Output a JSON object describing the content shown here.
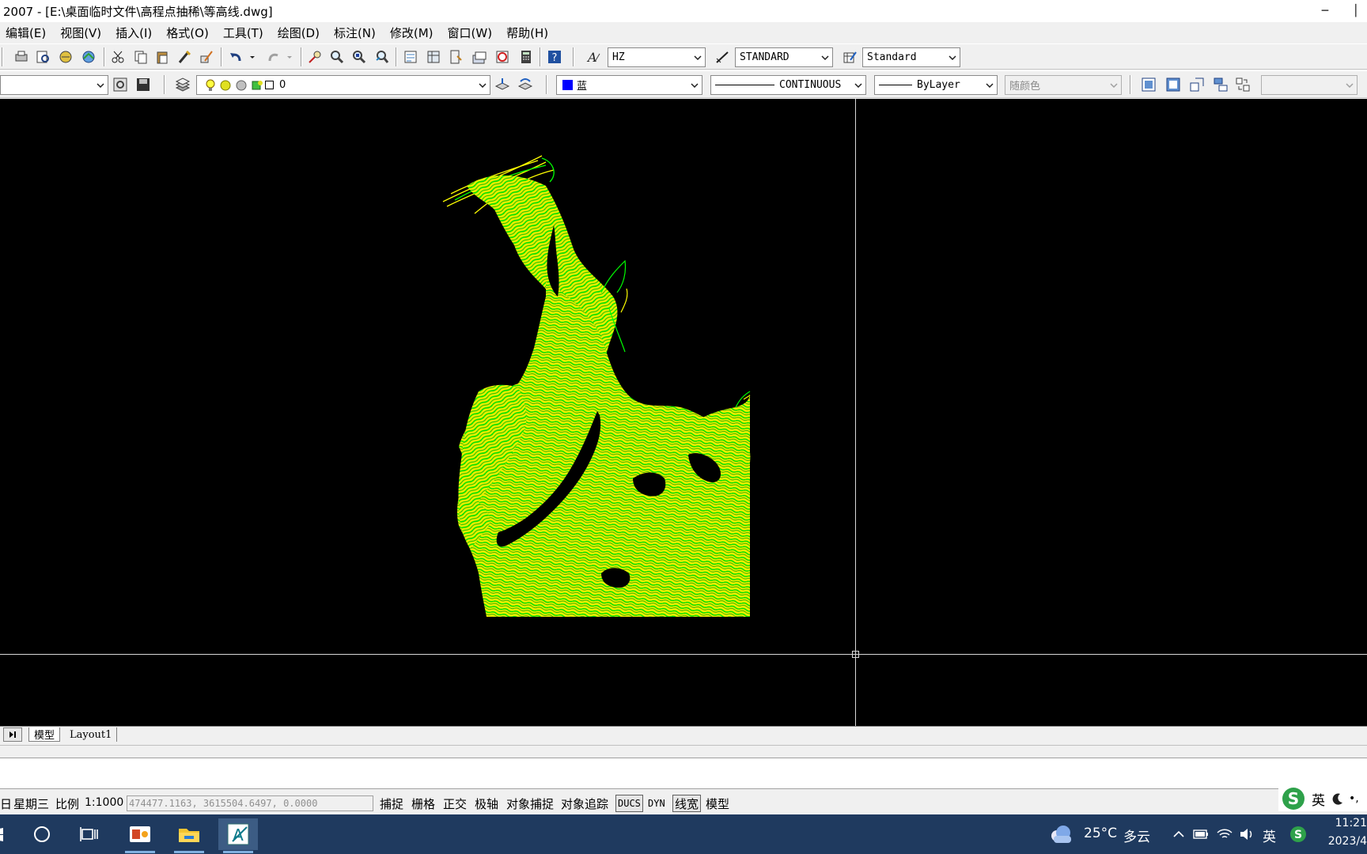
{
  "window": {
    "title": "2007 - [E:\\桌面临时文件\\高程点抽稀\\等高线.dwg]",
    "minimize_glyph": "─",
    "close_glyph": "│"
  },
  "menu": [
    "编辑(E)",
    "视图(V)",
    "插入(I)",
    "格式(O)",
    "工具(T)",
    "绘图(D)",
    "标注(N)",
    "修改(M)",
    "窗口(W)",
    "帮助(H)"
  ],
  "toolbar": {
    "text_style": "HZ",
    "dim_style": "STANDARD",
    "table_style": "Standard",
    "layer_name": "0",
    "color": "蓝",
    "color_hex": "#0000ff",
    "linetype": "CONTINUOUS",
    "lineweight": "ByLayer",
    "plot_style": "随颜色"
  },
  "tabs": {
    "model": "模型",
    "layout1": "Layout1"
  },
  "status": {
    "day": "日",
    "weekday": "星期三",
    "scale_label": "比例",
    "scale_value": "1:1000",
    "coordinates": "474477.1163, 3615504.6497, 0.0000",
    "buttons": [
      "捕捉",
      "栅格",
      "正交",
      "极轴",
      "对象捕捉",
      "对象追踪",
      "DUCS",
      "DYN",
      "线宽",
      "模型"
    ]
  },
  "ime": {
    "lang": "英"
  },
  "taskbar": {
    "weather_temp": "25°C",
    "weather_desc": "多云",
    "ime_lang": "英",
    "time": "11:21",
    "date": "2023/4"
  },
  "colors": {
    "contour_green": "#00ff00",
    "contour_yellow": "#ffff00",
    "canvas_bg": "#000000"
  }
}
